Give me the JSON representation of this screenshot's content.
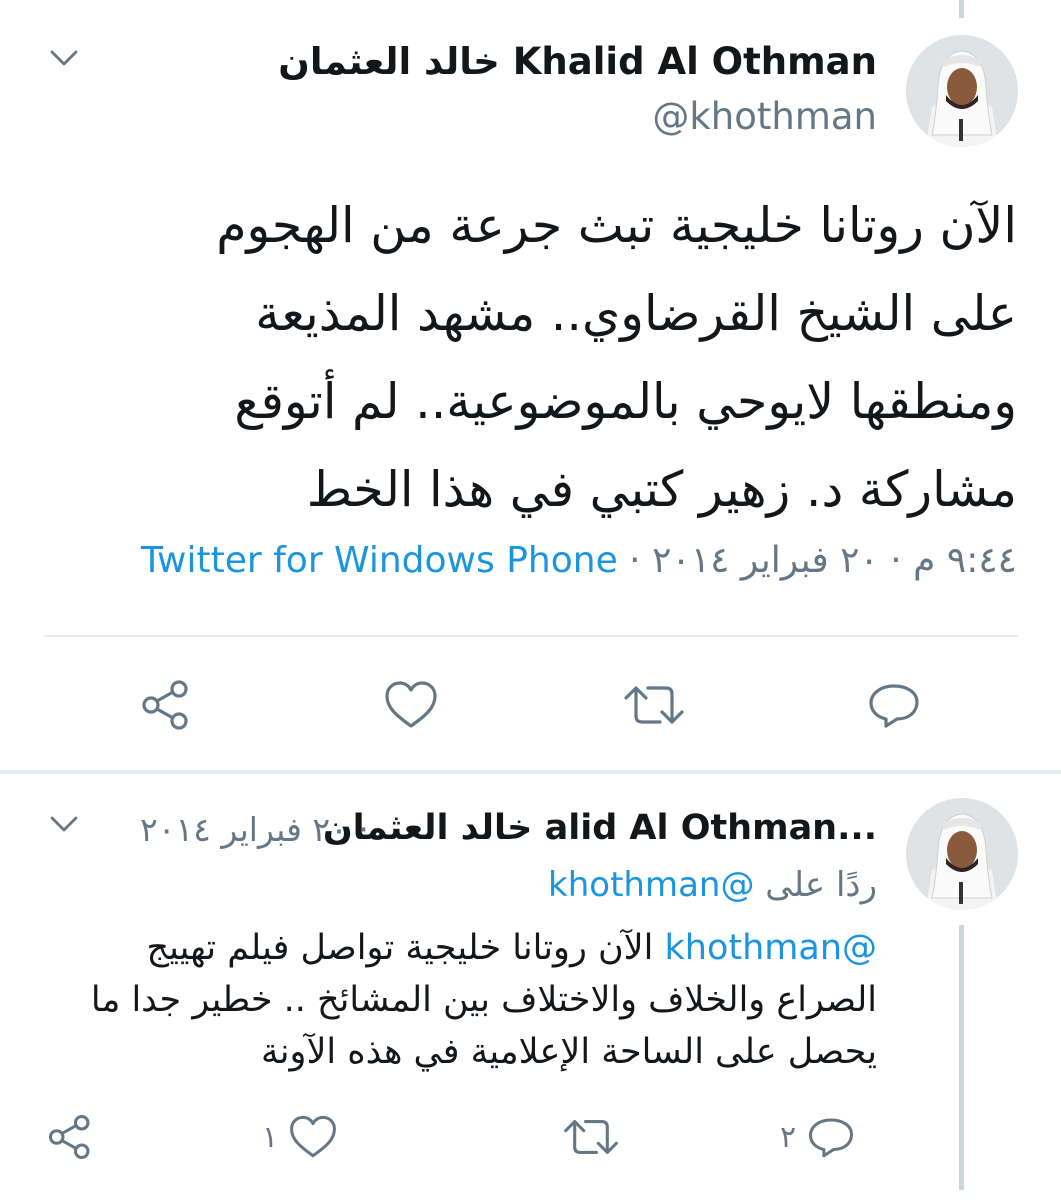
{
  "main_tweet": {
    "display_name": "خالد العثمان Khalid Al Othman",
    "handle": "@khothman",
    "text": "الآن روتانا خليجية تبث جرعة من الهجوم على الشيخ القرضاوي.. مشهد المذيعة ومنطقها لايوحي بالموضوعية.. لم أتوقع مشاركة د. زهير كتبي في هذا الخط",
    "timestamp": "٩:٤٤ م · ٢٠ فبراير ٢٠١٤ · ",
    "client": "Twitter for Windows Phone",
    "actions": {
      "reply_count": "",
      "retweet_count": "",
      "like_count": ""
    }
  },
  "reply_tweet": {
    "display_name": "خالد العثمان Khalid Al Othman",
    "display_name_truncated": "خالد العثمان alid Al Othman...",
    "date": "· ٢٠ فبراير ٢٠١٤",
    "replying_to_label": "ردًا على",
    "replying_to_mention": "@khothman",
    "mention": "@khothman",
    "text": " الآن روتانا خليجية تواصل فيلم تهييج الصراع والخلاف والاختلاف بين المشائخ .. خطير جدا ما يحصل على الساحة الإعلامية في هذه الآونة",
    "actions": {
      "reply_count": "٢",
      "retweet_count": "",
      "like_count": "١"
    }
  },
  "icons": [
    "chevron-down-icon",
    "reply-icon",
    "retweet-icon",
    "like-icon",
    "share-icon",
    "avatar"
  ],
  "colors": {
    "link": "#1b95e0",
    "secondary": "#657786",
    "text": "#14171a",
    "divider": "#e6ecf0",
    "thread": "#ccd6dd"
  }
}
